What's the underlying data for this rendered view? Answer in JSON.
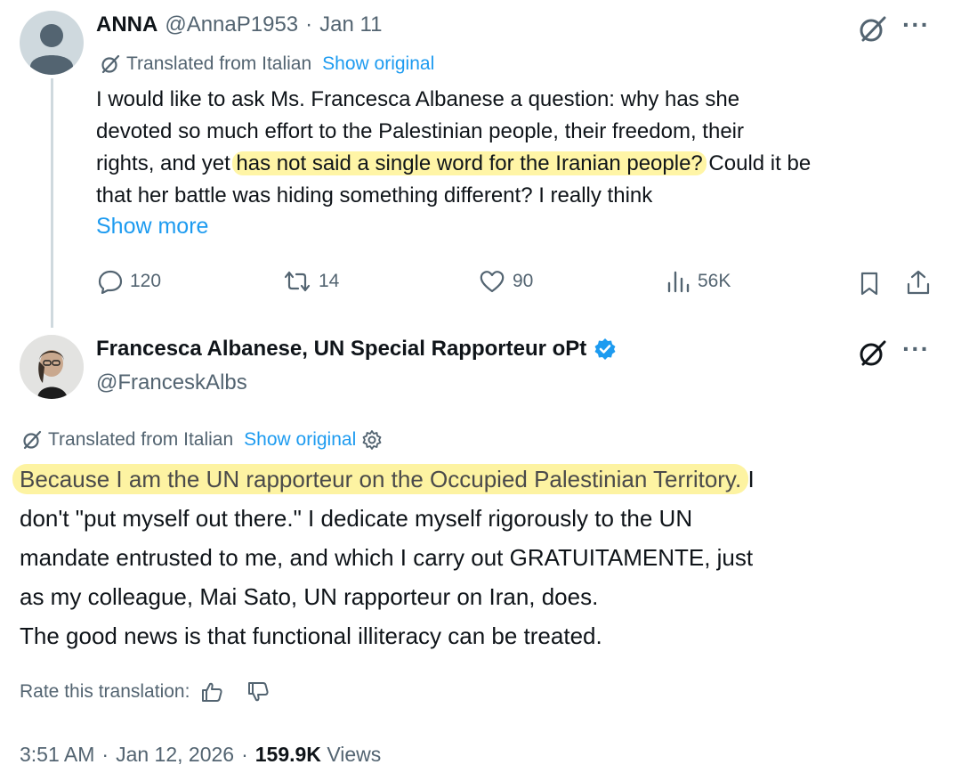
{
  "reply": {
    "name": "ANNA",
    "handle": "@AnnaP1953",
    "date_sep": "·",
    "date": "Jan 11",
    "translated_label": "Translated from Italian",
    "show_original": "Show original",
    "text_line1": "I would like to ask Ms. Francesca Albanese a question: why has she",
    "text_line2": "devoted so much effort to the Palestinian people, their freedom, their",
    "text_line3_pre": "rights, and yet ",
    "text_line3_hl": "has not said a single word for the Iranian people?",
    "text_line3_post": " Could it be",
    "text_line4": "that her battle was hiding something different? I really think",
    "show_more": "Show more",
    "replies": "120",
    "reposts": "14",
    "likes": "90",
    "views": "56K"
  },
  "main": {
    "name": "Francesca Albanese, UN Special Rapporteur oPt",
    "handle": "@FranceskAlbs",
    "translated_label": "Translated from Italian",
    "show_original": "Show original",
    "text_hl": "Because I am the UN rapporteur on the Occupied Palestinian Territory.",
    "text_line1_post": " I",
    "text_line2": "don't \"put myself out there.\" I dedicate myself rigorously to the UN",
    "text_line3": "mandate entrusted to me, and which I carry out GRATUITAMENTE, just",
    "text_line4": "as my colleague, Mai Sato, UN rapporteur on Iran, does.",
    "text_line5": "The good news is that functional illiteracy can be treated.",
    "rate_label": "Rate this translation:",
    "time": "3:51 AM",
    "sep1": "·",
    "date": "Jan 12, 2026",
    "sep2": "·",
    "views_count": "159.9K",
    "views_label": "Views"
  },
  "icons": {
    "grok": "grok-icon",
    "more": "more-icon",
    "reply": "reply-icon",
    "repost": "repost-icon",
    "like": "like-icon",
    "views": "views-icon",
    "bookmark": "bookmark-icon",
    "share": "share-icon",
    "verified": "verified-icon",
    "settings": "gear-icon",
    "thumbs_up": "thumbs-up-icon",
    "thumbs_down": "thumbs-down-icon"
  },
  "colors": {
    "accent": "#1d9bf0",
    "highlight": "#fff5a6",
    "muted": "#536471",
    "text": "#0f1419"
  }
}
